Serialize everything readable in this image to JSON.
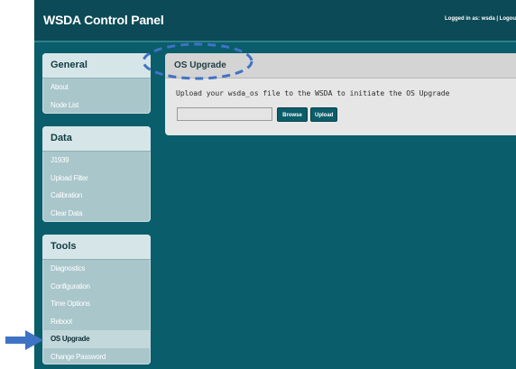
{
  "header": {
    "app_title": "WSDA Control Panel",
    "login_status": "Logged in as: wsda | Logou"
  },
  "sidebar": {
    "general": {
      "title": "General",
      "items": [
        "About",
        "Node List"
      ]
    },
    "data": {
      "title": "Data",
      "items": [
        "J1939",
        "Upload Filter",
        "Calibration",
        "Clear Data"
      ]
    },
    "tools": {
      "title": "Tools",
      "items": [
        "Diagnostics",
        "Configuration",
        "Time Options",
        "Reboot",
        "OS Upgrade",
        "Change Password"
      ],
      "active_item": "OS Upgrade"
    }
  },
  "main": {
    "title": "OS Upgrade",
    "instruction": "Upload your wsda_os file to the WSDA to initiate the OS Upgrade",
    "file_value": "",
    "browse_label": "Browse",
    "upload_label": "Upload"
  },
  "colors": {
    "header_bg": "#0b4a56",
    "page_bg": "#0a5d6b",
    "annotation": "#3f73c4"
  },
  "annotations": {
    "highlight": "dashed-ellipse",
    "pointer": "arrow-icon"
  }
}
